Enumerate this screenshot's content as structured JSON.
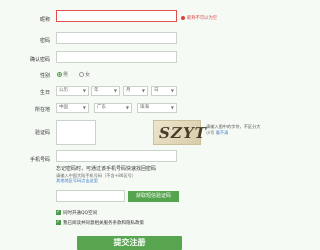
{
  "form": {
    "nickname_label": "昵称",
    "nickname_error": "昵称不可以为空",
    "password_label": "密码",
    "confirm_label": "确认密码",
    "gender_label": "性别",
    "gender_male": "男",
    "gender_female": "女",
    "birthday_label": "生日",
    "birthday_year": "公历",
    "birthday_year2": "年",
    "birthday_month": "月",
    "birthday_day": "日",
    "location_label": "所在地",
    "location_country": "中国",
    "location_province": "广东",
    "location_city": "珠海",
    "captcha_label": "验证码",
    "captcha_text": "SZYT",
    "captcha_tip": "请输入图中的字符，不区分大小写",
    "captcha_refresh": "看不清",
    "phone_label": "手机号码",
    "phone_hint": "忘记密码时，可通过该手机号码快速找回密码",
    "phone_hint2": "请输入中国大陆手机号码（不含+86区号）",
    "phone_hint3": "其他地区号码点击这里",
    "sms_button": "获取短信验证码",
    "agree_1": "同时开通QQ空间",
    "agree_2": "我已阅读并同意相关服务条款和隐私政策",
    "submit": "提交注册"
  },
  "colors": {
    "accent": "#54a44d",
    "error": "#d9433f"
  }
}
